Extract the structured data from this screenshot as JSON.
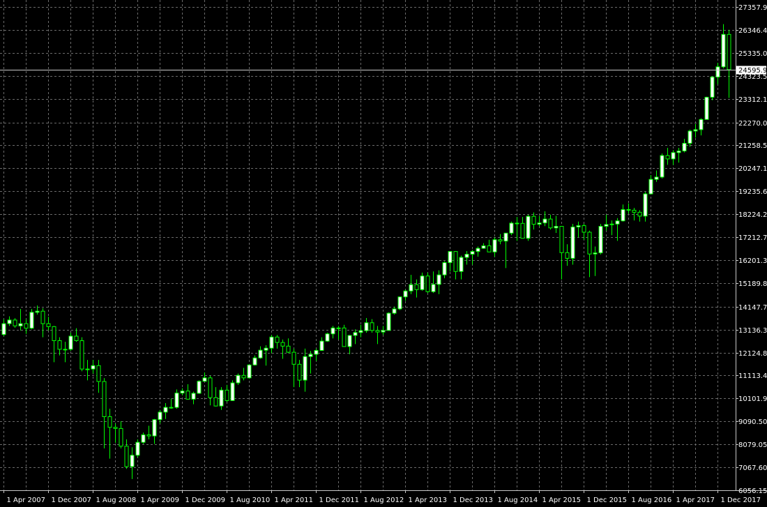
{
  "colors": {
    "background": "#000000",
    "grid": "#6b6b6b",
    "axis": "#c8c8c8",
    "text": "#ffffff",
    "bull_fill": "#ffffff",
    "bull_outline": "#00ff00",
    "bear_fill": "#000000",
    "bear_outline": "#00ff00",
    "wick": "#00ff00",
    "price_line": "#c8c8c8",
    "price_tag_bg": "#ffffff",
    "price_tag_text": "#000000"
  },
  "chart_data": {
    "type": "candlestick",
    "timeframe": "monthly",
    "title": "",
    "xlabel": "",
    "ylabel": "",
    "ylim": [
      6056.15,
      27357.9
    ],
    "xlim": [
      "2007-04",
      "2018-01"
    ],
    "grid": true,
    "y_ticks": [
      "6056.15",
      "7067.60",
      "8079.05",
      "9090.50",
      "10101.95",
      "11113.40",
      "12124.85",
      "13136.30",
      "14147.75",
      "15189.85",
      "16201.30",
      "17212.75",
      "18224.20",
      "19235.65",
      "20247.10",
      "21258.55",
      "22270.00",
      "23312.10",
      "24323.55",
      "25335.00",
      "26346.45",
      "27357.90"
    ],
    "x_ticks": [
      {
        "date": "2007-04",
        "label": "1 Apr 2007"
      },
      {
        "date": "2007-12",
        "label": "1 Dec 2007"
      },
      {
        "date": "2008-08",
        "label": "1 Aug 2008"
      },
      {
        "date": "2009-04",
        "label": "1 Apr 2009"
      },
      {
        "date": "2009-12",
        "label": "1 Dec 2009"
      },
      {
        "date": "2010-08",
        "label": "1 Aug 2010"
      },
      {
        "date": "2011-04",
        "label": "1 Apr 2011"
      },
      {
        "date": "2011-12",
        "label": "1 Dec 2011"
      },
      {
        "date": "2012-08",
        "label": "1 Aug 2012"
      },
      {
        "date": "2013-04",
        "label": "1 Apr 2013"
      },
      {
        "date": "2013-12",
        "label": "1 Dec 2013"
      },
      {
        "date": "2014-08",
        "label": "1 Aug 2014"
      },
      {
        "date": "2015-04",
        "label": "1 Apr 2015"
      },
      {
        "date": "2015-12",
        "label": "1 Dec 2015"
      },
      {
        "date": "2016-08",
        "label": "1 Aug 2016"
      },
      {
        "date": "2017-04",
        "label": "1 Apr 2017"
      },
      {
        "date": "2017-12",
        "label": "1 Dec 2017"
      }
    ],
    "current_price": "24595.90",
    "candles": [
      {
        "date": "2007-04",
        "o": 12920,
        "h": 13600,
        "l": 12850,
        "c": 13400
      },
      {
        "date": "2007-05",
        "o": 13400,
        "h": 13720,
        "l": 13300,
        "c": 13560
      },
      {
        "date": "2007-06",
        "o": 13560,
        "h": 13640,
        "l": 13220,
        "c": 13300
      },
      {
        "date": "2007-07",
        "o": 13300,
        "h": 14050,
        "l": 13100,
        "c": 13400
      },
      {
        "date": "2007-08",
        "o": 13400,
        "h": 13600,
        "l": 12950,
        "c": 13200
      },
      {
        "date": "2007-09",
        "o": 13200,
        "h": 14050,
        "l": 13150,
        "c": 13900
      },
      {
        "date": "2007-10",
        "o": 13900,
        "h": 14200,
        "l": 13800,
        "c": 13950
      },
      {
        "date": "2007-11",
        "o": 13950,
        "h": 14080,
        "l": 12800,
        "c": 13400
      },
      {
        "date": "2007-12",
        "o": 13400,
        "h": 13700,
        "l": 13100,
        "c": 13270
      },
      {
        "date": "2008-01",
        "o": 13270,
        "h": 13300,
        "l": 11700,
        "c": 12650
      },
      {
        "date": "2008-02",
        "o": 12650,
        "h": 12800,
        "l": 12000,
        "c": 12270
      },
      {
        "date": "2008-03",
        "o": 12270,
        "h": 12600,
        "l": 11700,
        "c": 12270
      },
      {
        "date": "2008-04",
        "o": 12270,
        "h": 13000,
        "l": 12200,
        "c": 12850
      },
      {
        "date": "2008-05",
        "o": 12850,
        "h": 13200,
        "l": 12600,
        "c": 12650
      },
      {
        "date": "2008-06",
        "o": 12650,
        "h": 12800,
        "l": 11300,
        "c": 11400
      },
      {
        "date": "2008-07",
        "o": 11400,
        "h": 11800,
        "l": 10900,
        "c": 11400
      },
      {
        "date": "2008-08",
        "o": 11400,
        "h": 11800,
        "l": 11200,
        "c": 11550
      },
      {
        "date": "2008-09",
        "o": 11550,
        "h": 11800,
        "l": 10350,
        "c": 10850
      },
      {
        "date": "2008-10",
        "o": 10850,
        "h": 11000,
        "l": 7900,
        "c": 9300
      },
      {
        "date": "2008-11",
        "o": 9300,
        "h": 9650,
        "l": 7450,
        "c": 8830
      },
      {
        "date": "2008-12",
        "o": 8830,
        "h": 9000,
        "l": 8150,
        "c": 8780
      },
      {
        "date": "2009-01",
        "o": 8780,
        "h": 9100,
        "l": 7900,
        "c": 8000
      },
      {
        "date": "2009-02",
        "o": 8000,
        "h": 8300,
        "l": 7000,
        "c": 7100
      },
      {
        "date": "2009-03",
        "o": 7100,
        "h": 7950,
        "l": 6550,
        "c": 7600
      },
      {
        "date": "2009-04",
        "o": 7600,
        "h": 8300,
        "l": 7500,
        "c": 8170
      },
      {
        "date": "2009-05",
        "o": 8170,
        "h": 8600,
        "l": 8100,
        "c": 8500
      },
      {
        "date": "2009-06",
        "o": 8500,
        "h": 8900,
        "l": 8300,
        "c": 8450
      },
      {
        "date": "2009-07",
        "o": 8450,
        "h": 9200,
        "l": 8100,
        "c": 9170
      },
      {
        "date": "2009-08",
        "o": 9170,
        "h": 9600,
        "l": 9000,
        "c": 9500
      },
      {
        "date": "2009-09",
        "o": 9500,
        "h": 9900,
        "l": 9200,
        "c": 9710
      },
      {
        "date": "2009-10",
        "o": 9710,
        "h": 10100,
        "l": 9650,
        "c": 9710
      },
      {
        "date": "2009-11",
        "o": 9710,
        "h": 10500,
        "l": 9650,
        "c": 10340
      },
      {
        "date": "2009-12",
        "o": 10340,
        "h": 10550,
        "l": 10250,
        "c": 10430
      },
      {
        "date": "2010-01",
        "o": 10430,
        "h": 10730,
        "l": 10050,
        "c": 10070
      },
      {
        "date": "2010-02",
        "o": 10070,
        "h": 10400,
        "l": 9850,
        "c": 10330
      },
      {
        "date": "2010-03",
        "o": 10330,
        "h": 10900,
        "l": 10300,
        "c": 10860
      },
      {
        "date": "2010-04",
        "o": 10860,
        "h": 11250,
        "l": 10850,
        "c": 11010
      },
      {
        "date": "2010-05",
        "o": 11010,
        "h": 11100,
        "l": 9800,
        "c": 10140
      },
      {
        "date": "2010-06",
        "o": 10140,
        "h": 10600,
        "l": 9750,
        "c": 9770
      },
      {
        "date": "2010-07",
        "o": 9770,
        "h": 10600,
        "l": 9600,
        "c": 10470
      },
      {
        "date": "2010-08",
        "o": 10470,
        "h": 10700,
        "l": 9950,
        "c": 10010
      },
      {
        "date": "2010-09",
        "o": 10010,
        "h": 10900,
        "l": 10000,
        "c": 10790
      },
      {
        "date": "2010-10",
        "o": 10790,
        "h": 11200,
        "l": 10700,
        "c": 11120
      },
      {
        "date": "2010-11",
        "o": 11120,
        "h": 11450,
        "l": 10900,
        "c": 11010
      },
      {
        "date": "2010-12",
        "o": 11010,
        "h": 11600,
        "l": 11000,
        "c": 11580
      },
      {
        "date": "2011-01",
        "o": 11580,
        "h": 12000,
        "l": 11550,
        "c": 11890
      },
      {
        "date": "2011-02",
        "o": 11890,
        "h": 12400,
        "l": 11850,
        "c": 12230
      },
      {
        "date": "2011-03",
        "o": 12230,
        "h": 12450,
        "l": 11550,
        "c": 12320
      },
      {
        "date": "2011-04",
        "o": 12320,
        "h": 12900,
        "l": 12100,
        "c": 12810
      },
      {
        "date": "2011-05",
        "o": 12810,
        "h": 12900,
        "l": 12300,
        "c": 12570
      },
      {
        "date": "2011-06",
        "o": 12570,
        "h": 12700,
        "l": 11850,
        "c": 12410
      },
      {
        "date": "2011-07",
        "o": 12410,
        "h": 12750,
        "l": 12100,
        "c": 12140
      },
      {
        "date": "2011-08",
        "o": 12140,
        "h": 12300,
        "l": 10600,
        "c": 11610
      },
      {
        "date": "2011-09",
        "o": 11610,
        "h": 11800,
        "l": 10600,
        "c": 10910
      },
      {
        "date": "2011-10",
        "o": 10910,
        "h": 12300,
        "l": 10400,
        "c": 11950
      },
      {
        "date": "2011-11",
        "o": 11950,
        "h": 12200,
        "l": 11200,
        "c": 12050
      },
      {
        "date": "2011-12",
        "o": 12050,
        "h": 12300,
        "l": 11750,
        "c": 12220
      },
      {
        "date": "2012-01",
        "o": 12220,
        "h": 12800,
        "l": 12200,
        "c": 12630
      },
      {
        "date": "2012-02",
        "o": 12630,
        "h": 13000,
        "l": 12600,
        "c": 12950
      },
      {
        "date": "2012-03",
        "o": 12950,
        "h": 13300,
        "l": 12750,
        "c": 13210
      },
      {
        "date": "2012-04",
        "o": 13210,
        "h": 13300,
        "l": 12700,
        "c": 13210
      },
      {
        "date": "2012-05",
        "o": 13210,
        "h": 13350,
        "l": 12400,
        "c": 12390
      },
      {
        "date": "2012-06",
        "o": 12390,
        "h": 12900,
        "l": 12050,
        "c": 12880
      },
      {
        "date": "2012-07",
        "o": 12880,
        "h": 13150,
        "l": 12500,
        "c": 13010
      },
      {
        "date": "2012-08",
        "o": 13010,
        "h": 13350,
        "l": 12800,
        "c": 13090
      },
      {
        "date": "2012-09",
        "o": 13090,
        "h": 13650,
        "l": 13000,
        "c": 13440
      },
      {
        "date": "2012-10",
        "o": 13440,
        "h": 13600,
        "l": 13000,
        "c": 13100
      },
      {
        "date": "2012-11",
        "o": 13100,
        "h": 13300,
        "l": 12500,
        "c": 13030
      },
      {
        "date": "2012-12",
        "o": 13030,
        "h": 13300,
        "l": 12900,
        "c": 13100
      },
      {
        "date": "2013-01",
        "o": 13100,
        "h": 13900,
        "l": 13100,
        "c": 13860
      },
      {
        "date": "2013-02",
        "o": 13860,
        "h": 14150,
        "l": 13800,
        "c": 14050
      },
      {
        "date": "2013-03",
        "o": 14050,
        "h": 14600,
        "l": 14000,
        "c": 14580
      },
      {
        "date": "2013-04",
        "o": 14580,
        "h": 14900,
        "l": 14400,
        "c": 14840
      },
      {
        "date": "2013-05",
        "o": 14840,
        "h": 15550,
        "l": 14700,
        "c": 15120
      },
      {
        "date": "2013-06",
        "o": 15120,
        "h": 15350,
        "l": 14550,
        "c": 14900
      },
      {
        "date": "2013-07",
        "o": 14900,
        "h": 15650,
        "l": 14850,
        "c": 15500
      },
      {
        "date": "2013-08",
        "o": 15500,
        "h": 15650,
        "l": 14750,
        "c": 14810
      },
      {
        "date": "2013-09",
        "o": 14810,
        "h": 15700,
        "l": 14750,
        "c": 15130
      },
      {
        "date": "2013-10",
        "o": 15130,
        "h": 15750,
        "l": 14700,
        "c": 15550
      },
      {
        "date": "2013-11",
        "o": 15550,
        "h": 16150,
        "l": 15400,
        "c": 16090
      },
      {
        "date": "2013-12",
        "o": 16090,
        "h": 16600,
        "l": 15700,
        "c": 16580
      },
      {
        "date": "2014-01",
        "o": 16580,
        "h": 16600,
        "l": 15350,
        "c": 15700
      },
      {
        "date": "2014-02",
        "o": 15700,
        "h": 16400,
        "l": 15350,
        "c": 16320
      },
      {
        "date": "2014-03",
        "o": 16320,
        "h": 16600,
        "l": 16000,
        "c": 16460
      },
      {
        "date": "2014-04",
        "o": 16460,
        "h": 16650,
        "l": 16000,
        "c": 16580
      },
      {
        "date": "2014-05",
        "o": 16580,
        "h": 16800,
        "l": 16350,
        "c": 16720
      },
      {
        "date": "2014-06",
        "o": 16720,
        "h": 16950,
        "l": 16700,
        "c": 16830
      },
      {
        "date": "2014-07",
        "o": 16830,
        "h": 17100,
        "l": 16550,
        "c": 16560
      },
      {
        "date": "2014-08",
        "o": 16560,
        "h": 17200,
        "l": 16350,
        "c": 17100
      },
      {
        "date": "2014-09",
        "o": 17100,
        "h": 17350,
        "l": 16900,
        "c": 17040
      },
      {
        "date": "2014-10",
        "o": 17040,
        "h": 17400,
        "l": 15850,
        "c": 17390
      },
      {
        "date": "2014-11",
        "o": 17390,
        "h": 17900,
        "l": 17300,
        "c": 17830
      },
      {
        "date": "2014-12",
        "o": 17830,
        "h": 18100,
        "l": 17050,
        "c": 17820
      },
      {
        "date": "2015-01",
        "o": 17820,
        "h": 18100,
        "l": 17150,
        "c": 17160
      },
      {
        "date": "2015-02",
        "o": 17160,
        "h": 18200,
        "l": 17050,
        "c": 18130
      },
      {
        "date": "2015-03",
        "o": 18130,
        "h": 18300,
        "l": 17550,
        "c": 17780
      },
      {
        "date": "2015-04",
        "o": 17780,
        "h": 18150,
        "l": 17700,
        "c": 17840
      },
      {
        "date": "2015-05",
        "o": 17840,
        "h": 18350,
        "l": 17700,
        "c": 18010
      },
      {
        "date": "2015-06",
        "o": 18010,
        "h": 18200,
        "l": 17550,
        "c": 17620
      },
      {
        "date": "2015-07",
        "o": 17620,
        "h": 18150,
        "l": 17400,
        "c": 17690
      },
      {
        "date": "2015-08",
        "o": 17690,
        "h": 17700,
        "l": 15350,
        "c": 16530
      },
      {
        "date": "2015-09",
        "o": 16530,
        "h": 16900,
        "l": 15950,
        "c": 16280
      },
      {
        "date": "2015-10",
        "o": 16280,
        "h": 17800,
        "l": 16000,
        "c": 17660
      },
      {
        "date": "2015-11",
        "o": 17660,
        "h": 17900,
        "l": 17200,
        "c": 17720
      },
      {
        "date": "2015-12",
        "o": 17720,
        "h": 17800,
        "l": 17100,
        "c": 17430
      },
      {
        "date": "2016-01",
        "o": 17430,
        "h": 17500,
        "l": 15450,
        "c": 16470
      },
      {
        "date": "2016-02",
        "o": 16470,
        "h": 16800,
        "l": 15500,
        "c": 16520
      },
      {
        "date": "2016-03",
        "o": 16520,
        "h": 17800,
        "l": 16450,
        "c": 17690
      },
      {
        "date": "2016-04",
        "o": 17690,
        "h": 18200,
        "l": 17500,
        "c": 17770
      },
      {
        "date": "2016-05",
        "o": 17770,
        "h": 17950,
        "l": 17300,
        "c": 17790
      },
      {
        "date": "2016-06",
        "o": 17790,
        "h": 18050,
        "l": 17050,
        "c": 17930
      },
      {
        "date": "2016-07",
        "o": 17930,
        "h": 18650,
        "l": 17900,
        "c": 18430
      },
      {
        "date": "2016-08",
        "o": 18430,
        "h": 18700,
        "l": 18250,
        "c": 18400
      },
      {
        "date": "2016-09",
        "o": 18400,
        "h": 18500,
        "l": 17950,
        "c": 18310
      },
      {
        "date": "2016-10",
        "o": 18310,
        "h": 18400,
        "l": 17900,
        "c": 18140
      },
      {
        "date": "2016-11",
        "o": 18140,
        "h": 19200,
        "l": 17900,
        "c": 19120
      },
      {
        "date": "2016-12",
        "o": 19120,
        "h": 19950,
        "l": 19100,
        "c": 19760
      },
      {
        "date": "2017-01",
        "o": 19760,
        "h": 20150,
        "l": 19650,
        "c": 19860
      },
      {
        "date": "2017-02",
        "o": 19860,
        "h": 20900,
        "l": 19800,
        "c": 20810
      },
      {
        "date": "2017-03",
        "o": 20810,
        "h": 21150,
        "l": 20400,
        "c": 20660
      },
      {
        "date": "2017-04",
        "o": 20660,
        "h": 21050,
        "l": 20400,
        "c": 20940
      },
      {
        "date": "2017-05",
        "o": 20940,
        "h": 21150,
        "l": 20500,
        "c": 21010
      },
      {
        "date": "2017-06",
        "o": 21010,
        "h": 21550,
        "l": 20950,
        "c": 21350
      },
      {
        "date": "2017-07",
        "o": 21350,
        "h": 21950,
        "l": 21200,
        "c": 21890
      },
      {
        "date": "2017-08",
        "o": 21890,
        "h": 22200,
        "l": 21600,
        "c": 21950
      },
      {
        "date": "2017-09",
        "o": 21950,
        "h": 22450,
        "l": 21700,
        "c": 22400
      },
      {
        "date": "2017-10",
        "o": 22400,
        "h": 23400,
        "l": 22400,
        "c": 23380
      },
      {
        "date": "2017-11",
        "o": 23380,
        "h": 24300,
        "l": 23250,
        "c": 24270
      },
      {
        "date": "2017-12",
        "o": 24270,
        "h": 24900,
        "l": 23950,
        "c": 24720
      },
      {
        "date": "2018-01",
        "o": 24720,
        "h": 26600,
        "l": 24650,
        "c": 26150
      },
      {
        "date": "2018-02",
        "o": 26150,
        "h": 26350,
        "l": 23350,
        "c": 24595.9
      }
    ]
  }
}
